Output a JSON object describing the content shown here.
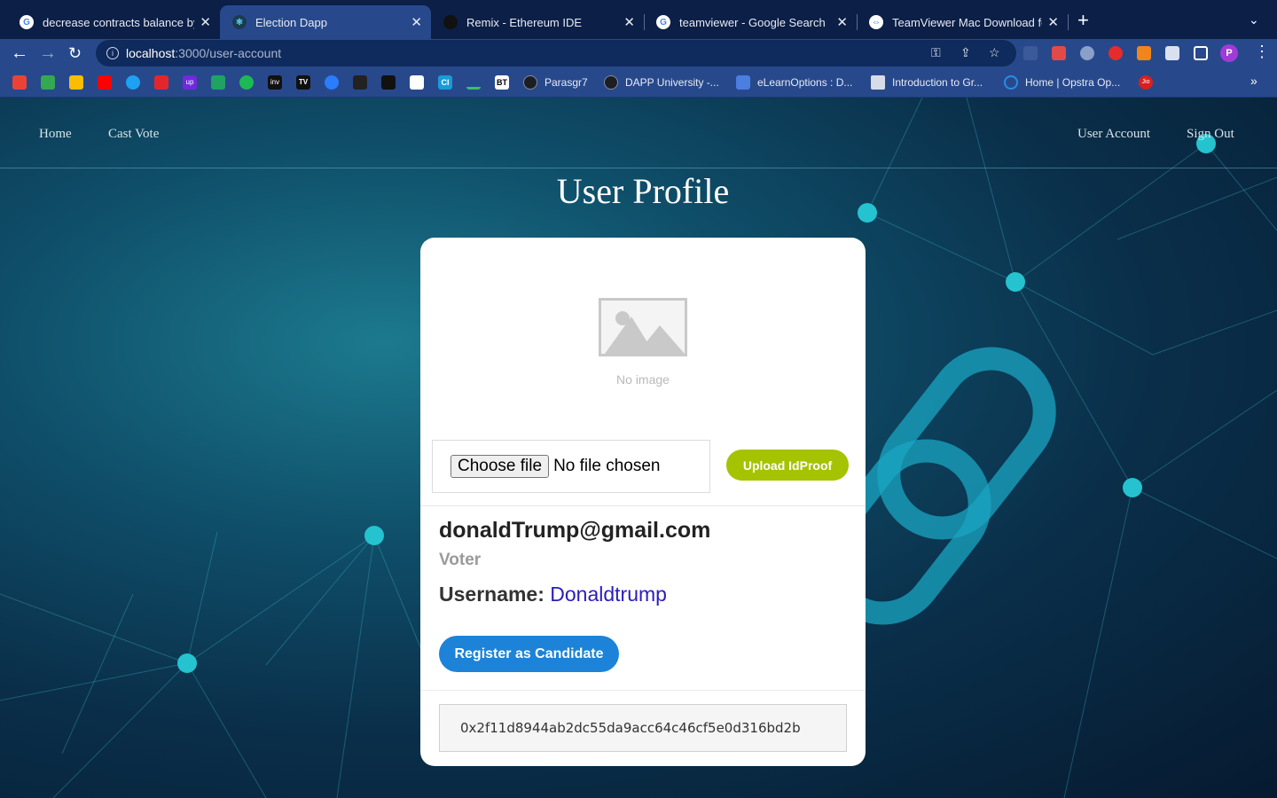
{
  "browser": {
    "tabs": [
      {
        "title": "decrease contracts balance by",
        "icon": "google-icon"
      },
      {
        "title": "Election Dapp",
        "icon": "react-icon"
      },
      {
        "title": "Remix - Ethereum IDE",
        "icon": "remix-icon"
      },
      {
        "title": "teamviewer - Google Search",
        "icon": "google-icon"
      },
      {
        "title": "TeamViewer Mac Download for",
        "icon": "teamviewer-icon"
      }
    ],
    "active_tab_index": 1,
    "url_host": "localhost",
    "url_path": ":3000/user-account",
    "profile_initial": "P",
    "bookmarks": [
      {
        "label": "Parasgr7",
        "icon": "github-icon"
      },
      {
        "label": "DAPP University -...",
        "icon": "github-icon"
      },
      {
        "label": "eLearnOptions : D...",
        "icon": "elearn-icon"
      },
      {
        "label": "Introduction to Gr...",
        "icon": "doc-icon"
      },
      {
        "label": "Home | Opstra Op...",
        "icon": "opstra-icon"
      }
    ],
    "bookmark_icon_labels": {
      "inv": "inv",
      "tv": "TV",
      "ci": "CI",
      "bt": "BT",
      "upwork": "up",
      "jio": "Jio"
    }
  },
  "nav": {
    "home": "Home",
    "cast_vote": "Cast Vote",
    "user_account": "User Account",
    "sign_out": "Sign Out"
  },
  "page": {
    "title": "User Profile"
  },
  "profile": {
    "no_image_label": "No image",
    "choose_file_label": "Choose file",
    "no_file_text": "No file chosen",
    "upload_button": "Upload IdProof",
    "email": "donaldTrump@gmail.com",
    "role": "Voter",
    "username_label": "Username:",
    "username": "Donaldtrump",
    "register_button": "Register as Candidate",
    "wallet_address": "0x2f11d8944ab2dc55da9acc64c46cf5e0d316bd2b"
  },
  "colors": {
    "chrome_bg": "#0b1f47",
    "toolbar_bg": "#27498c",
    "upload_button": "#a5c300",
    "register_button": "#1c83d8",
    "username_link": "#2a1dbd"
  }
}
